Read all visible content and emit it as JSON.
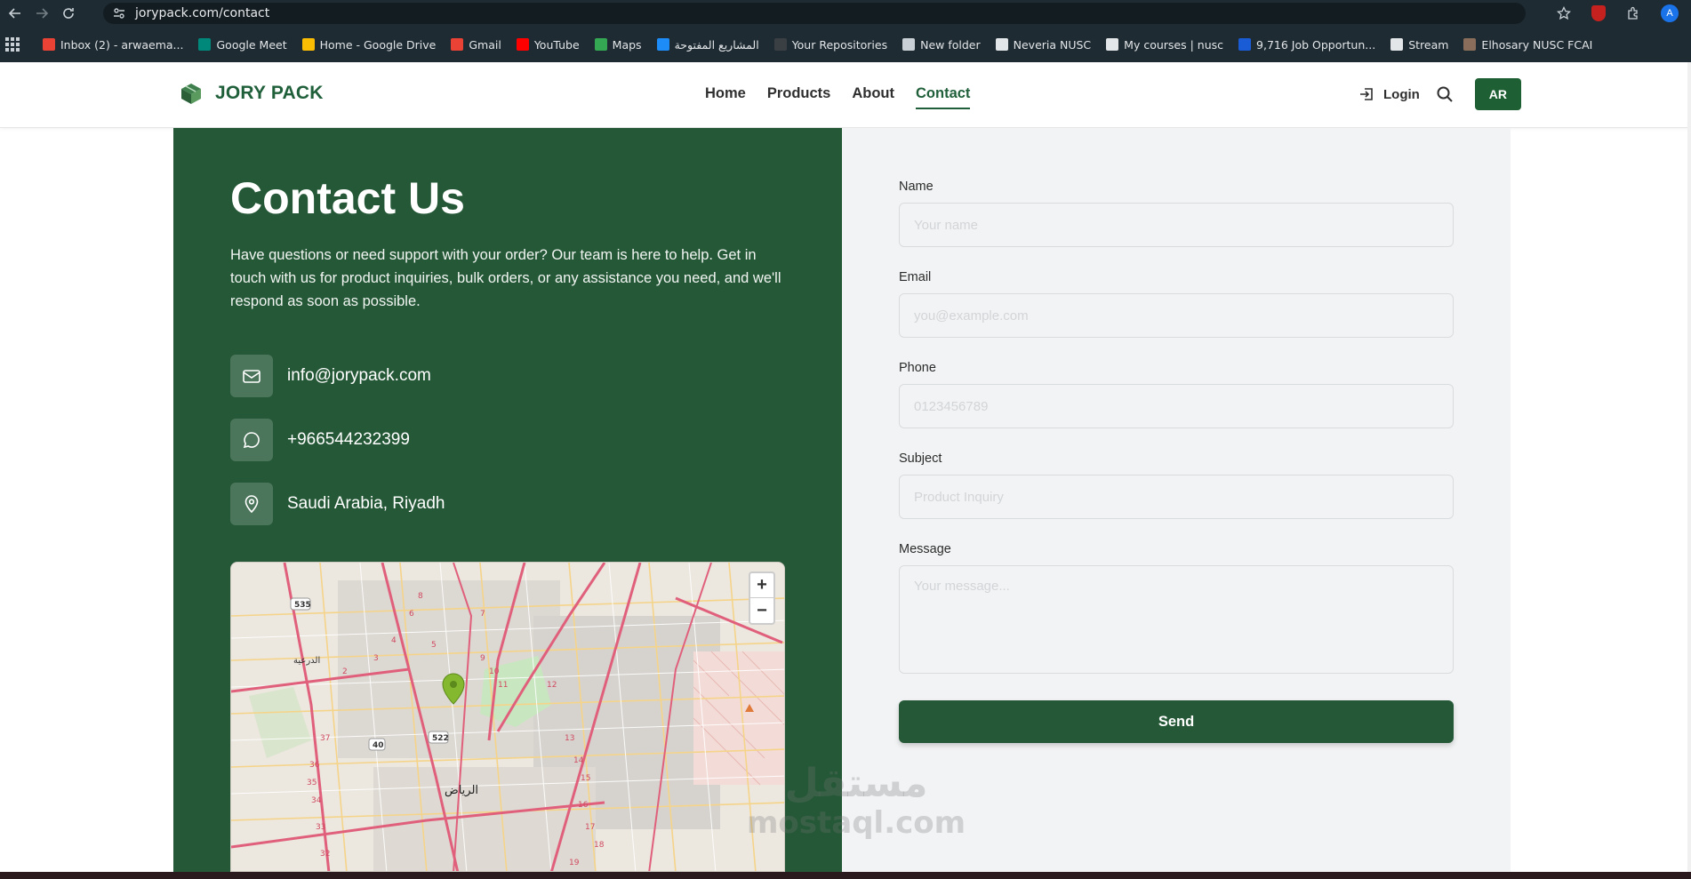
{
  "browser": {
    "url": "jorypack.com/contact",
    "profile_initial": "A",
    "bookmarks": [
      {
        "label": "Inbox (2) - arwaema...",
        "color": "#ea4335"
      },
      {
        "label": "Google Meet",
        "color": "#00897b"
      },
      {
        "label": "Home - Google Drive",
        "color": "#fbbc04"
      },
      {
        "label": "Gmail",
        "color": "#ea4335"
      },
      {
        "label": "YouTube",
        "color": "#ff0000"
      },
      {
        "label": "Maps",
        "color": "#34a853"
      },
      {
        "label": "المشاريع المفتوحة",
        "color": "#1d8cf8"
      },
      {
        "label": "Your Repositories",
        "color": "#3a3f44"
      },
      {
        "label": "New folder",
        "color": "#c9d1d6"
      },
      {
        "label": "Neveria NUSC",
        "color": "#e3e6e8"
      },
      {
        "label": "My courses | nusc",
        "color": "#e3e6e8"
      },
      {
        "label": "9,716 Job Opportun...",
        "color": "#1a5bd6"
      },
      {
        "label": "Stream",
        "color": "#e3e6e8"
      },
      {
        "label": "Elhosary NUSC FCAI",
        "color": "#8a6d5a"
      }
    ]
  },
  "header": {
    "brand": "JORY PACK",
    "nav": [
      "Home",
      "Products",
      "About",
      "Contact"
    ],
    "active_nav": "Contact",
    "login_label": "Login",
    "lang_label": "AR"
  },
  "contact": {
    "title": "Contact Us",
    "description": "Have questions or need support with your order? Our team is here to help. Get in touch with us for product inquiries, bulk orders, or any assistance you need, and we'll respond as soon as possible.",
    "email": "info@jorypack.com",
    "phone": "+966544232399",
    "location": "Saudi Arabia, Riyadh",
    "map": {
      "zoom_in": "+",
      "zoom_out": "−",
      "labels": [
        "535",
        "الدرعية",
        "522",
        "40",
        "الرياض"
      ]
    }
  },
  "form": {
    "name_label": "Name",
    "name_placeholder": "Your name",
    "email_label": "Email",
    "email_placeholder": "you@example.com",
    "phone_label": "Phone",
    "phone_placeholder": "0123456789",
    "subject_label": "Subject",
    "subject_placeholder": "Product Inquiry",
    "message_label": "Message",
    "message_placeholder": "Your message...",
    "send_label": "Send"
  },
  "watermark": {
    "line1": "مستقل",
    "line2": "mostaql.com"
  },
  "colors": {
    "brand_green": "#255837",
    "nav_active": "#1f5f3a"
  }
}
